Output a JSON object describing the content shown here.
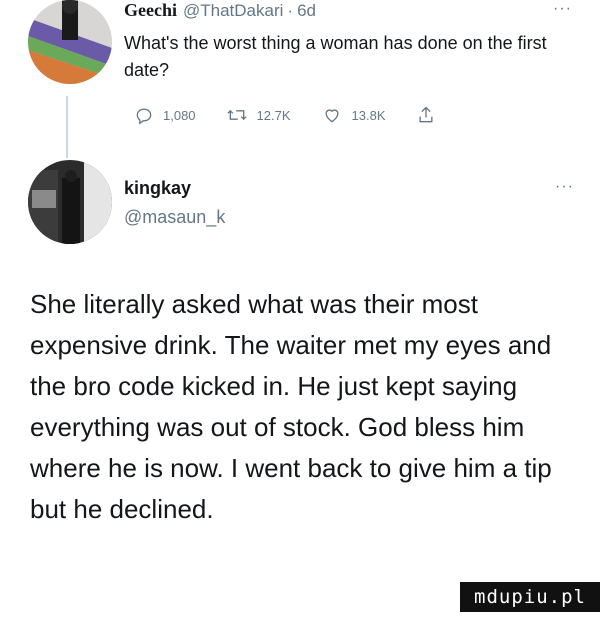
{
  "quoted_tweet": {
    "display_name": "Geechi",
    "handle": "@ThatDakari",
    "separator": "·",
    "time": "6d",
    "more": "···",
    "text": "What's the worst thing a woman has done on the first date?",
    "actions": {
      "replies": "1,080",
      "retweets": "12.7K",
      "likes": "13.8K"
    },
    "icons": [
      "reply-icon",
      "retweet-icon",
      "like-icon",
      "share-icon"
    ]
  },
  "reply_tweet": {
    "display_name": "kingkay",
    "handle": "@masaun_k",
    "more": "···",
    "text": "She literally asked what was their most expensive drink. The waiter met my eyes and the bro code kicked in. He just kept saying everything was out of stock. God bless him where he is now. I went back to give him a tip but he declined."
  },
  "watermark": {
    "text": "mdupiu.pl"
  }
}
